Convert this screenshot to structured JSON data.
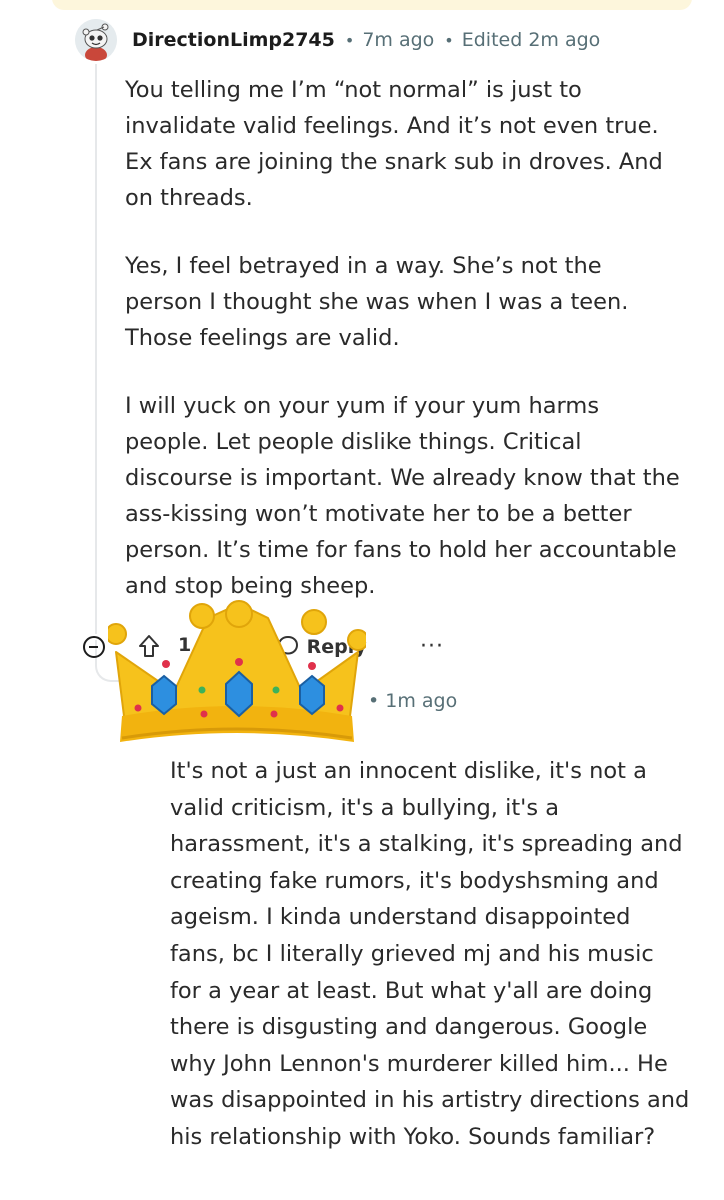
{
  "comment": {
    "author": "DirectionLimp2745",
    "time": "7m ago",
    "edited": "Edited 2m ago",
    "paragraphs": [
      "You telling me I’m “not normal” is just to invalidate valid feelings. And it’s not even true. Ex fans are joining the snark sub in droves. And on threads.",
      "Yes, I feel betrayed in a way. She’s not the person I thought she was when I was a teen. Those feelings are valid.",
      "I will yuck on your yum if your yum harms people. Let people dislike things. Critical discourse is important. We already know that the ass-kissing won’t motivate her to be a better person. It’s time for fans to hold her accountable and stop being sheep."
    ],
    "actions": {
      "upvote_count": "1",
      "reply_label": "Reply",
      "more": "···"
    }
  },
  "reply": {
    "time": "1m ago",
    "body": "It's not a just an innocent dislike, it's not a valid criticism, it's a bullying, it's a harassment, it's a stalking, it's spreading and creating fake rumors, it's bodyshsming and ageism. I kinda  understand disappointed fans, bc  I literally grieved mj and his music for a year at least. But what y'all are doing there is disgusting and dangerous. Google why John Lennon's murderer killed him... He was disappointed in his artistry directions and his relationship with Yoko. Sounds familiar?"
  },
  "overlay": {
    "emoji": "crown-emoji"
  },
  "colors": {
    "text": "#1c1c1c",
    "meta": "#576f76",
    "thread_line": "#e6e8ea",
    "crown_gold": "#f6c21c",
    "gem_blue": "#2d8fe0",
    "gem_red": "#e0314b"
  }
}
